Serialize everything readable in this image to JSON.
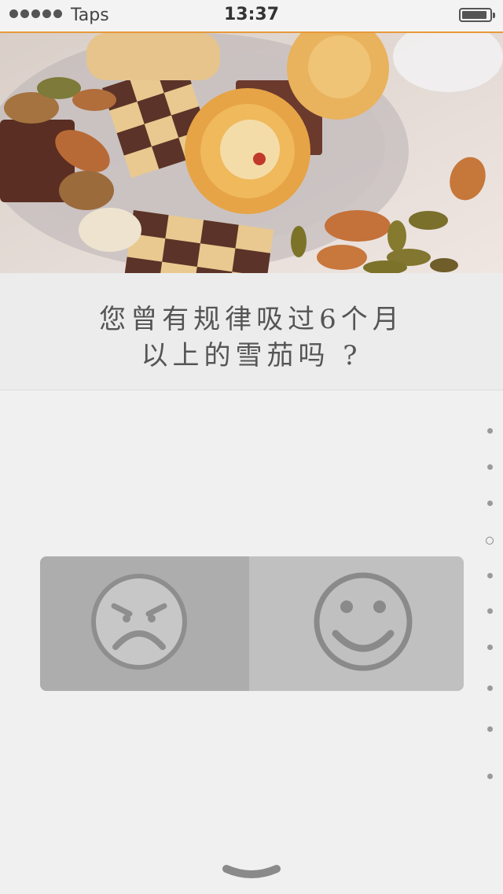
{
  "status_bar": {
    "carrier": "Taps",
    "time": "13:37",
    "battery_level": 0.9
  },
  "hero": {
    "image_icon": "cookies-and-almonds-photo"
  },
  "question": {
    "line1": "您曾有规律吸过6个月",
    "line2": "以上的雪茄吗 ?"
  },
  "choices": [
    {
      "id": "no",
      "icon": "frown-face-icon"
    },
    {
      "id": "yes",
      "icon": "smile-face-icon"
    }
  ],
  "pagination": {
    "total": 10,
    "current": 4
  },
  "colors": {
    "accent": "#e89a3a",
    "card_left": "#adadad",
    "card_right": "#c0c0c0",
    "face": "#8e8e8e"
  }
}
